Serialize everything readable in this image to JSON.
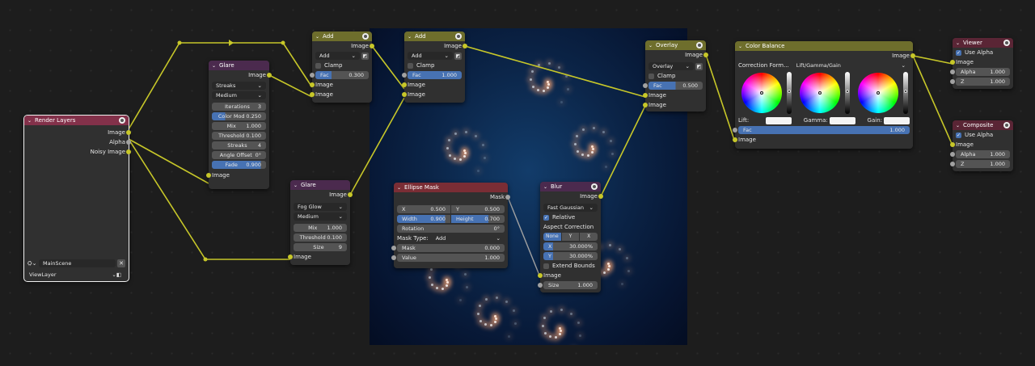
{
  "render_layers": {
    "title": "Render Layers",
    "outputs": [
      "Image",
      "Alpha",
      "Noisy Image"
    ],
    "scene": "MainScene",
    "view_layer": "ViewLayer"
  },
  "glare1": {
    "title": "Glare",
    "output": "Image",
    "type": "Streaks",
    "quality": "Medium",
    "fields": [
      {
        "label": "Iterations",
        "value": "3"
      },
      {
        "label": "Color Mod",
        "value": "0.250"
      },
      {
        "label": "Mix",
        "value": "1.000"
      },
      {
        "label": "Threshold",
        "value": "0.100"
      },
      {
        "label": "Streaks",
        "value": "4"
      },
      {
        "label": "Angle Offset",
        "value": "0°"
      },
      {
        "label": "Fade",
        "value": "0.900"
      }
    ],
    "input": "Image"
  },
  "glare2": {
    "title": "Glare",
    "output": "Image",
    "type": "Fog Glow",
    "quality": "Medium",
    "fields": [
      {
        "label": "Mix",
        "value": "1.000"
      },
      {
        "label": "Threshold",
        "value": "0.100"
      },
      {
        "label": "Size",
        "value": "9"
      }
    ],
    "input": "Image"
  },
  "add1": {
    "title": "Add",
    "output": "Image",
    "mode": "Add",
    "clamp": "Clamp",
    "fac_label": "Fac",
    "fac_value": "0.300",
    "inputs": [
      "Image",
      "Image"
    ]
  },
  "add2": {
    "title": "Add",
    "output": "Image",
    "mode": "Add",
    "clamp": "Clamp",
    "fac_label": "Fac",
    "fac_value": "1.000",
    "inputs": [
      "Image",
      "Image"
    ]
  },
  "ellipse_mask": {
    "title": "Ellipse Mask",
    "output": "Mask",
    "x_label": "X",
    "x_value": "0.500",
    "y_label": "Y",
    "y_value": "0.500",
    "width_label": "Width",
    "width_value": "0.900",
    "height_label": "Height",
    "height_value": "0.700",
    "rotation_label": "Rotation",
    "rotation_value": "0°",
    "mask_type_label": "Mask Type:",
    "mask_type_value": "Add",
    "mask_label": "Mask",
    "mask_value": "0.000",
    "value_label": "Value",
    "value_value": "1.000"
  },
  "blur": {
    "title": "Blur",
    "output": "Image",
    "filter": "Fast Gaussian",
    "relative": "Relative",
    "aspect_label": "Aspect Correction",
    "aspect_options": [
      "None",
      "Y",
      "X"
    ],
    "x_label": "X",
    "x_value": "30.000%",
    "y_label": "Y",
    "y_value": "30.000%",
    "extend": "Extend Bounds",
    "input": "Image",
    "size_label": "Size",
    "size_value": "1.000"
  },
  "overlay": {
    "title": "Overlay",
    "output": "Image",
    "mode": "Overlay",
    "clamp": "Clamp",
    "fac_label": "Fac",
    "fac_value": "0.500",
    "inputs": [
      "Image",
      "Image"
    ]
  },
  "color_balance": {
    "title": "Color Balance",
    "output": "Image",
    "formula_label": "Correction Form...",
    "formula_value": "Lift/Gamma/Gain",
    "lift": "Lift:",
    "gamma": "Gamma:",
    "gain": "Gain:",
    "fac_label": "Fac",
    "fac_value": "1.000",
    "input": "Image"
  },
  "viewer": {
    "title": "Viewer",
    "use_alpha": "Use Alpha",
    "input": "Image",
    "alpha_label": "Alpha",
    "alpha_value": "1.000",
    "z_label": "Z",
    "z_value": "1.000"
  },
  "composite": {
    "title": "Composite",
    "use_alpha": "Use Alpha",
    "input": "Image",
    "alpha_label": "Alpha",
    "alpha_value": "1.000",
    "z_label": "Z",
    "z_value": "1.000"
  },
  "colors": {
    "wire": "#c7c729",
    "image_socket": "#c7c729",
    "value_socket": "#a1a1a1",
    "accent": "#4772b3"
  }
}
